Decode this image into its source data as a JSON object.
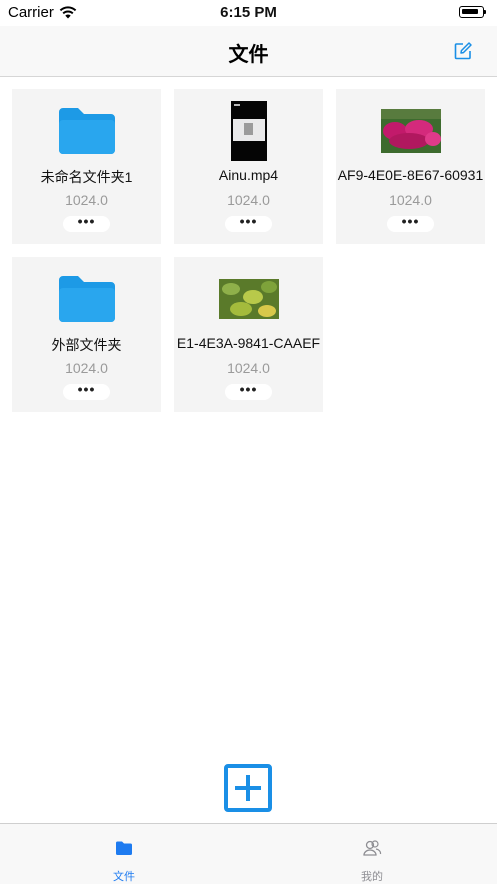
{
  "status_bar": {
    "carrier": "Carrier",
    "time": "6:15 PM"
  },
  "nav": {
    "title": "文件",
    "edit_icon": "edit-icon"
  },
  "files": [
    {
      "name": "未命名文件夹1",
      "size": "1024.0",
      "more": "•••",
      "kind": "folder"
    },
    {
      "name": "Ainu.mp4",
      "size": "1024.0",
      "more": "•••",
      "kind": "video"
    },
    {
      "name": "AF9-4E0E-8E67-60931",
      "size": "1024.0",
      "more": "•••",
      "kind": "photo-flowers"
    },
    {
      "name": "外部文件夹",
      "size": "1024.0",
      "more": "•••",
      "kind": "folder"
    },
    {
      "name": "E1-4E3A-9841-CAAEF",
      "size": "1024.0",
      "more": "•••",
      "kind": "photo-leaves"
    }
  ],
  "colors": {
    "accent": "#1a8fe6",
    "folder": "#1d9ae6",
    "tab_active": "#1e7bf0",
    "tab_inactive": "#8e8e93"
  },
  "tabs": [
    {
      "label": "文件",
      "icon": "folder-icon",
      "active": true
    },
    {
      "label": "我的",
      "icon": "people-icon",
      "active": false
    }
  ]
}
